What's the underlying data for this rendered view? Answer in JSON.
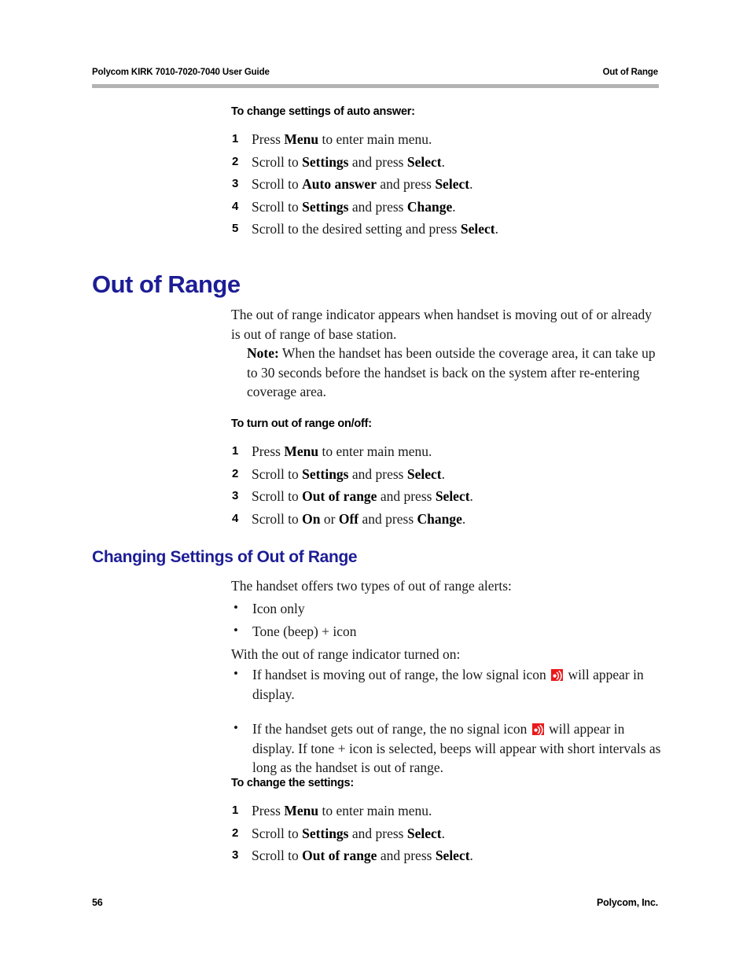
{
  "header": {
    "left": "Polycom KIRK 7010-7020-7040 User Guide",
    "right": "Out of Range"
  },
  "footer": {
    "page_number": "56",
    "company": "Polycom, Inc."
  },
  "colors": {
    "heading_blue": "#1d1d96",
    "rule_grey": "#b3b3b3",
    "icon_red": "#ea1a1c"
  },
  "procedures": {
    "auto_answer": {
      "title": "To change settings of auto answer:",
      "steps": [
        {
          "num": "1",
          "pre": "Press ",
          "b1": "Menu",
          "mid": " to enter main menu.",
          "b2": "",
          "post": ""
        },
        {
          "num": "2",
          "pre": "Scroll to ",
          "b1": "Settings",
          "mid": " and press ",
          "b2": "Select",
          "post": "."
        },
        {
          "num": "3",
          "pre": "Scroll to ",
          "b1": "Auto answer",
          "mid": " and press ",
          "b2": "Select",
          "post": "."
        },
        {
          "num": "4",
          "pre": "Scroll to ",
          "b1": "Settings",
          "mid": " and press ",
          "b2": "Change",
          "post": "."
        },
        {
          "num": "5",
          "pre": "Scroll to the desired setting and press ",
          "b1": "Select",
          "mid": "",
          "b2": "",
          "post": "."
        }
      ]
    },
    "turn_on_off": {
      "title": "To turn out of range on/off:",
      "steps": [
        {
          "num": "1",
          "pre": "Press ",
          "b1": "Menu",
          "mid": " to enter main menu.",
          "b2": "",
          "post": ""
        },
        {
          "num": "2",
          "pre": "Scroll to ",
          "b1": "Settings",
          "mid": " and press ",
          "b2": "Select",
          "post": "."
        },
        {
          "num": "3",
          "pre": "Scroll to ",
          "b1": "Out of range",
          "mid": " and press ",
          "b2": "Select",
          "post": "."
        },
        {
          "num": "4",
          "pre": "Scroll to ",
          "b1": "On",
          "mid": " or ",
          "b2": "Off",
          "post": " and press ",
          "b3": "Change",
          "tail": "."
        }
      ]
    },
    "change_settings": {
      "title": "To change the settings:",
      "steps": [
        {
          "num": "1",
          "pre": "Press ",
          "b1": "Menu",
          "mid": " to enter main menu.",
          "b2": "",
          "post": ""
        },
        {
          "num": "2",
          "pre": "Scroll to ",
          "b1": "Settings",
          "mid": " and press ",
          "b2": "Select",
          "post": "."
        },
        {
          "num": "3",
          "pre": "Scroll to ",
          "b1": "Out of range",
          "mid": " and press ",
          "b2": "Select",
          "post": "."
        }
      ]
    }
  },
  "sections": {
    "out_of_range": {
      "heading": "Out of Range",
      "intro": "The out of range indicator appears when handset is moving out of or already is out of range of base station.",
      "note_label": "Note:",
      "note_text": " When the handset has been outside the coverage area, it can take up to 30 seconds before the handset is back on the system after re-entering coverage area."
    },
    "changing_settings": {
      "heading": "Changing Settings of Out of Range",
      "intro": "The handset offers two types of out of range alerts:",
      "alert_types": [
        "Icon only",
        "Tone (beep) + icon"
      ],
      "indicator_lead": "With the out of range indicator turned on:",
      "indicator_bullets": [
        {
          "pre": "If handset is moving out of range, the low signal icon ",
          "icon": "low-signal-icon",
          "post": " will appear in display."
        },
        {
          "pre": "If the handset gets out of range, the no signal icon ",
          "icon": "no-signal-icon",
          "post": " will appear in display. If tone + icon is selected, beeps will appear with short intervals as long as the handset is out of range."
        }
      ]
    }
  }
}
